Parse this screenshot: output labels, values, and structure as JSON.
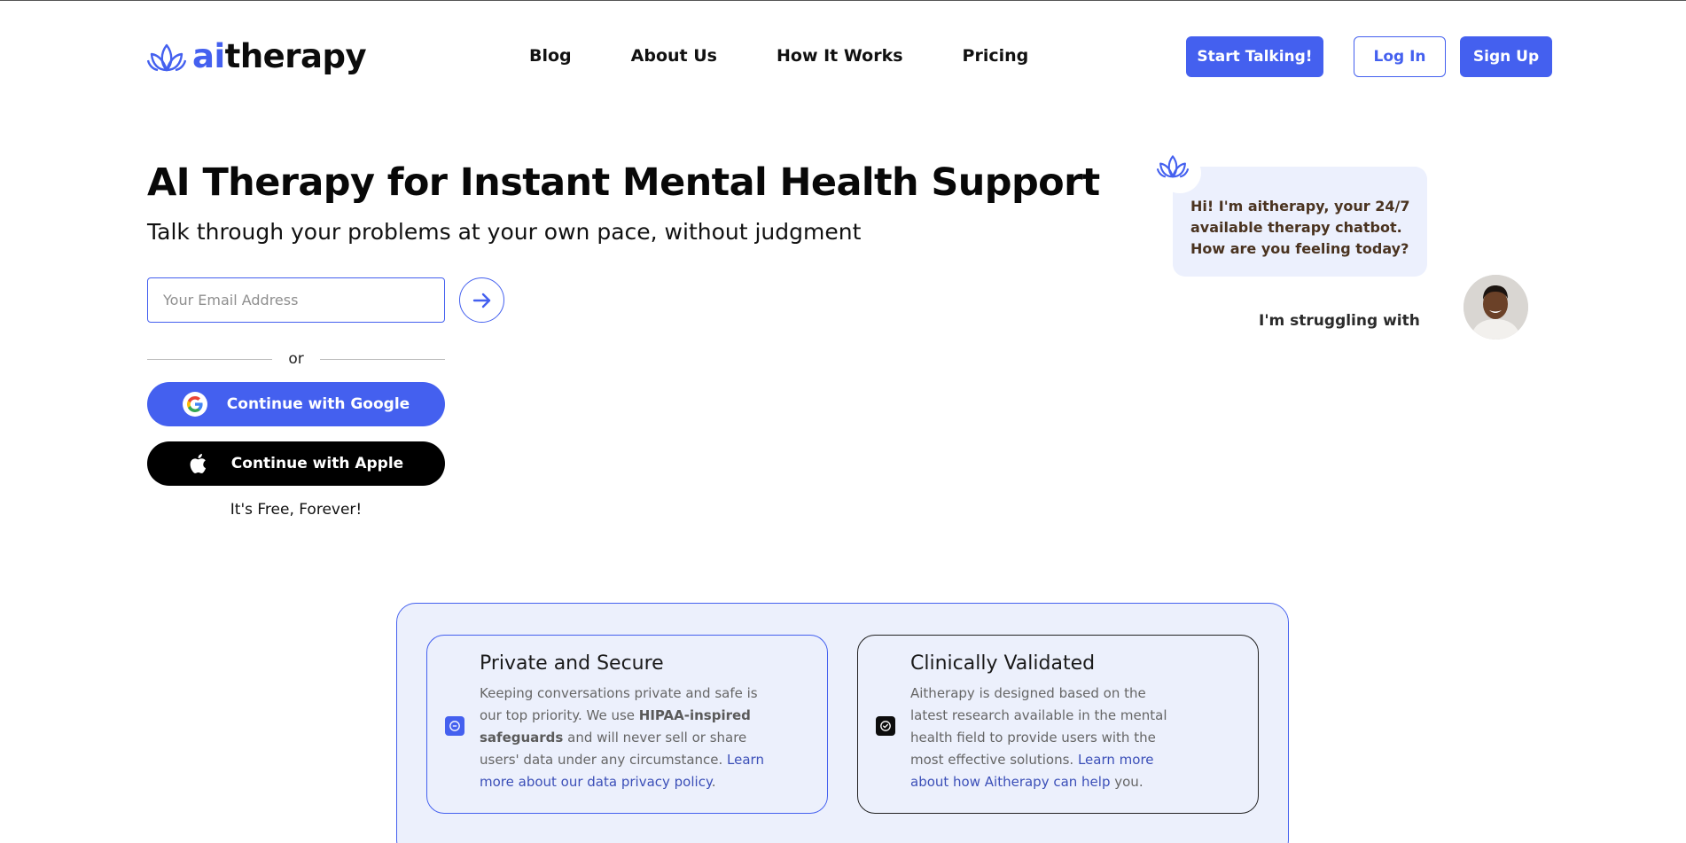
{
  "brand": {
    "prefix": "ai",
    "rest": "therapy",
    "accent_color": "#4460ef",
    "logo_icon": "lotus-icon"
  },
  "nav": {
    "items": [
      {
        "label": "Blog"
      },
      {
        "label": "About Us"
      },
      {
        "label": "How It Works"
      },
      {
        "label": "Pricing"
      }
    ]
  },
  "header_actions": {
    "start_label": "Start Talking!",
    "login_label": "Log In",
    "signup_label": "Sign Up"
  },
  "hero": {
    "title": "AI Therapy for Instant Mental Health Support",
    "subtitle": "Talk through your problems at your own pace, without judgment",
    "email_placeholder": "Your Email Address",
    "submit_icon": "arrow-right-icon",
    "or_label": "or",
    "google_label": "Continue with Google",
    "apple_label": "Continue with Apple",
    "free_note": "It's Free, Forever!"
  },
  "chat": {
    "bot_message": "Hi! I'm aitherapy, your 24/7 available therapy chatbot. How are you feeling today?",
    "user_message": "I'm struggling with"
  },
  "features": [
    {
      "title": "Private and Secure",
      "icon": "shield-icon",
      "body_pre": "Keeping conversations private and safe is our top priority. We use ",
      "body_bold": "HIPAA-inspired safeguards",
      "body_mid": " and will never sell or share users' data under any circumstance. ",
      "link": "Learn more about our data privacy policy",
      "body_end": "."
    },
    {
      "title": "Clinically Validated",
      "icon": "check-badge-icon",
      "body_pre": "Aitherapy is designed based on the latest research available in the mental health field to provide users with the most effective solutions. ",
      "link": "Learn more about how Aitherapy can help",
      "body_end": " you."
    }
  ]
}
